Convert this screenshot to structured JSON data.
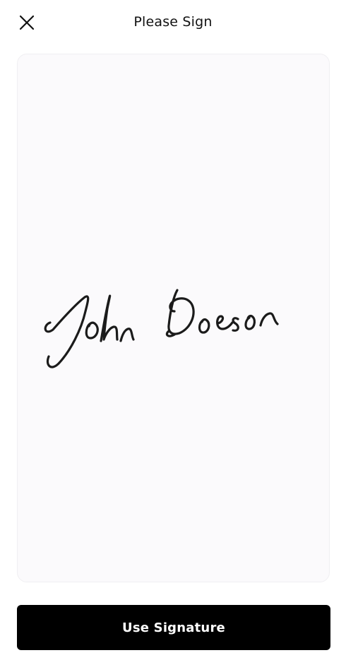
{
  "header": {
    "close_icon": "close-icon",
    "title": "Please Sign"
  },
  "signature_pad": {
    "signature_text": "John Doeson"
  },
  "footer": {
    "use_signature_label": "Use Signature"
  }
}
